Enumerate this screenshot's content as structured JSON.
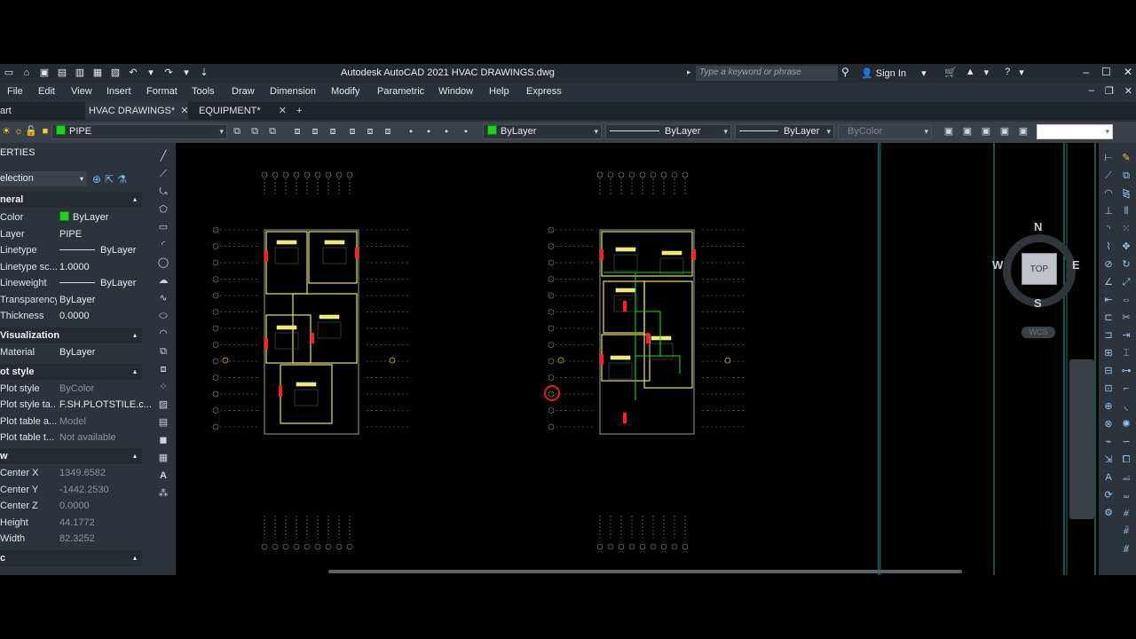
{
  "titlebar": {
    "title": "Autodesk AutoCAD 2021    HVAC DRAWINGS.dwg",
    "search_placeholder": "Type a keyword or phrase",
    "sign_in": "Sign In"
  },
  "menu": [
    "File",
    "Edit",
    "View",
    "Insert",
    "Format",
    "Tools",
    "Draw",
    "Dimension",
    "Modify",
    "Parametric",
    "Window",
    "Help",
    "Express"
  ],
  "tabs": {
    "start": "art",
    "items": [
      {
        "label": "HVAC DRAWINGS*"
      },
      {
        "label": "EQUIPMENT*"
      }
    ],
    "add": "+"
  },
  "toolbar": {
    "layer": "PIPE",
    "color": "ByLayer",
    "linetype": "ByLayer",
    "lineweight": "ByLayer",
    "plotstyle": "ByColor"
  },
  "properties": {
    "title": "ERTIES",
    "selection": "election",
    "sections": {
      "general": "neral",
      "visualization": "Visualization",
      "plot": "ot style",
      "view": "w",
      "misc": "c"
    },
    "general": [
      {
        "label": "Color",
        "value": "ByLayer"
      },
      {
        "label": "Layer",
        "value": "PIPE"
      },
      {
        "label": "Linetype",
        "value": "ByLayer"
      },
      {
        "label": "Linetype sc...",
        "value": "1.0000"
      },
      {
        "label": "Lineweight",
        "value": "ByLayer"
      },
      {
        "label": "Transparency",
        "value": "ByLayer"
      },
      {
        "label": "Thickness",
        "value": "0.0000"
      }
    ],
    "visualization": [
      {
        "label": "Material",
        "value": "ByLayer"
      }
    ],
    "plot": [
      {
        "label": "Plot style",
        "value": "ByColor"
      },
      {
        "label": "Plot style ta...",
        "value": "F.SH.PLOTSTILE.c..."
      },
      {
        "label": "Plot table a...",
        "value": "Model"
      },
      {
        "label": "Plot table t...",
        "value": "Not available"
      }
    ],
    "view": [
      {
        "label": "Center X",
        "value": "1349.6582"
      },
      {
        "label": "Center Y",
        "value": "-1442.2530"
      },
      {
        "label": "Center Z",
        "value": "0.0000"
      },
      {
        "label": "Height",
        "value": "44.1772"
      },
      {
        "label": "Width",
        "value": "82.3252"
      }
    ]
  },
  "viewcube": {
    "top": "TOP",
    "n": "N",
    "s": "S",
    "e": "E",
    "w": "W",
    "wcs": "WCS"
  },
  "colors": {
    "pipe": "#1fd01f",
    "wall": "#e8e066",
    "equipment": "#ff2020",
    "grid": "#8a8a8a"
  }
}
